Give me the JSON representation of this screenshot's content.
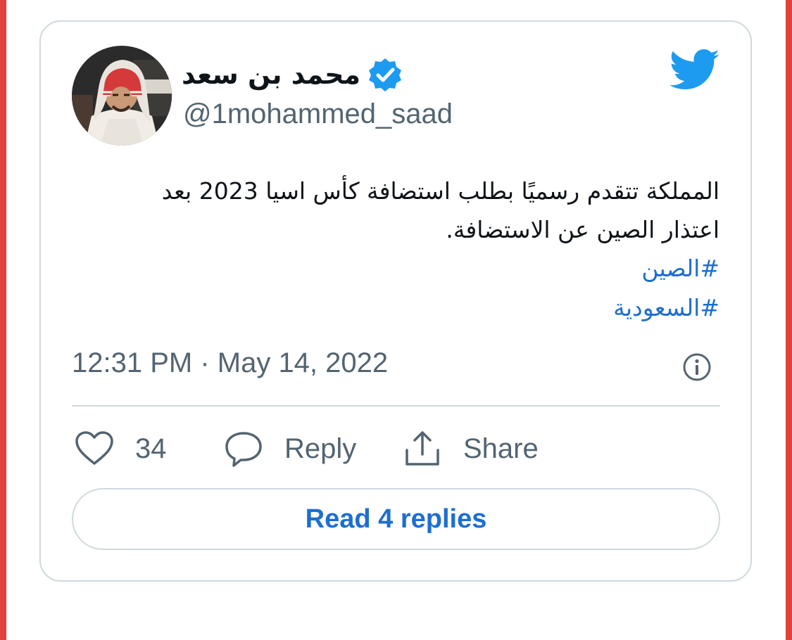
{
  "tweet": {
    "author": {
      "display_name": "محمد بن سعد",
      "handle": "@1mohammed_saad",
      "verified_icon": "verified-badge-icon",
      "avatar": "profile-photo"
    },
    "brand_icon": "twitter-bird-icon",
    "text_line_1": "المملكة تتقدم رسميًا بطلب استضافة كأس اسيا 2023 بعد",
    "text_line_2": "اعتذار الصين عن الاستضافة.",
    "hashtags": [
      "#الصين",
      "#السعودية"
    ],
    "timestamp": "12:31 PM · May 14, 2022",
    "info_icon": "info-icon"
  },
  "actions": {
    "like": {
      "icon": "heart-icon",
      "count": "34"
    },
    "reply": {
      "icon": "speech-bubble-icon",
      "label": "Reply"
    },
    "share": {
      "icon": "share-upload-icon",
      "label": "Share"
    }
  },
  "read_replies_label": "Read 4 replies",
  "colors": {
    "link_blue": "#1d6fd0",
    "twitter_blue": "#1d9bf0",
    "text_primary": "#0f1419",
    "text_secondary": "#536471",
    "border": "#cfd9de",
    "edge_red": "#e2403a"
  }
}
